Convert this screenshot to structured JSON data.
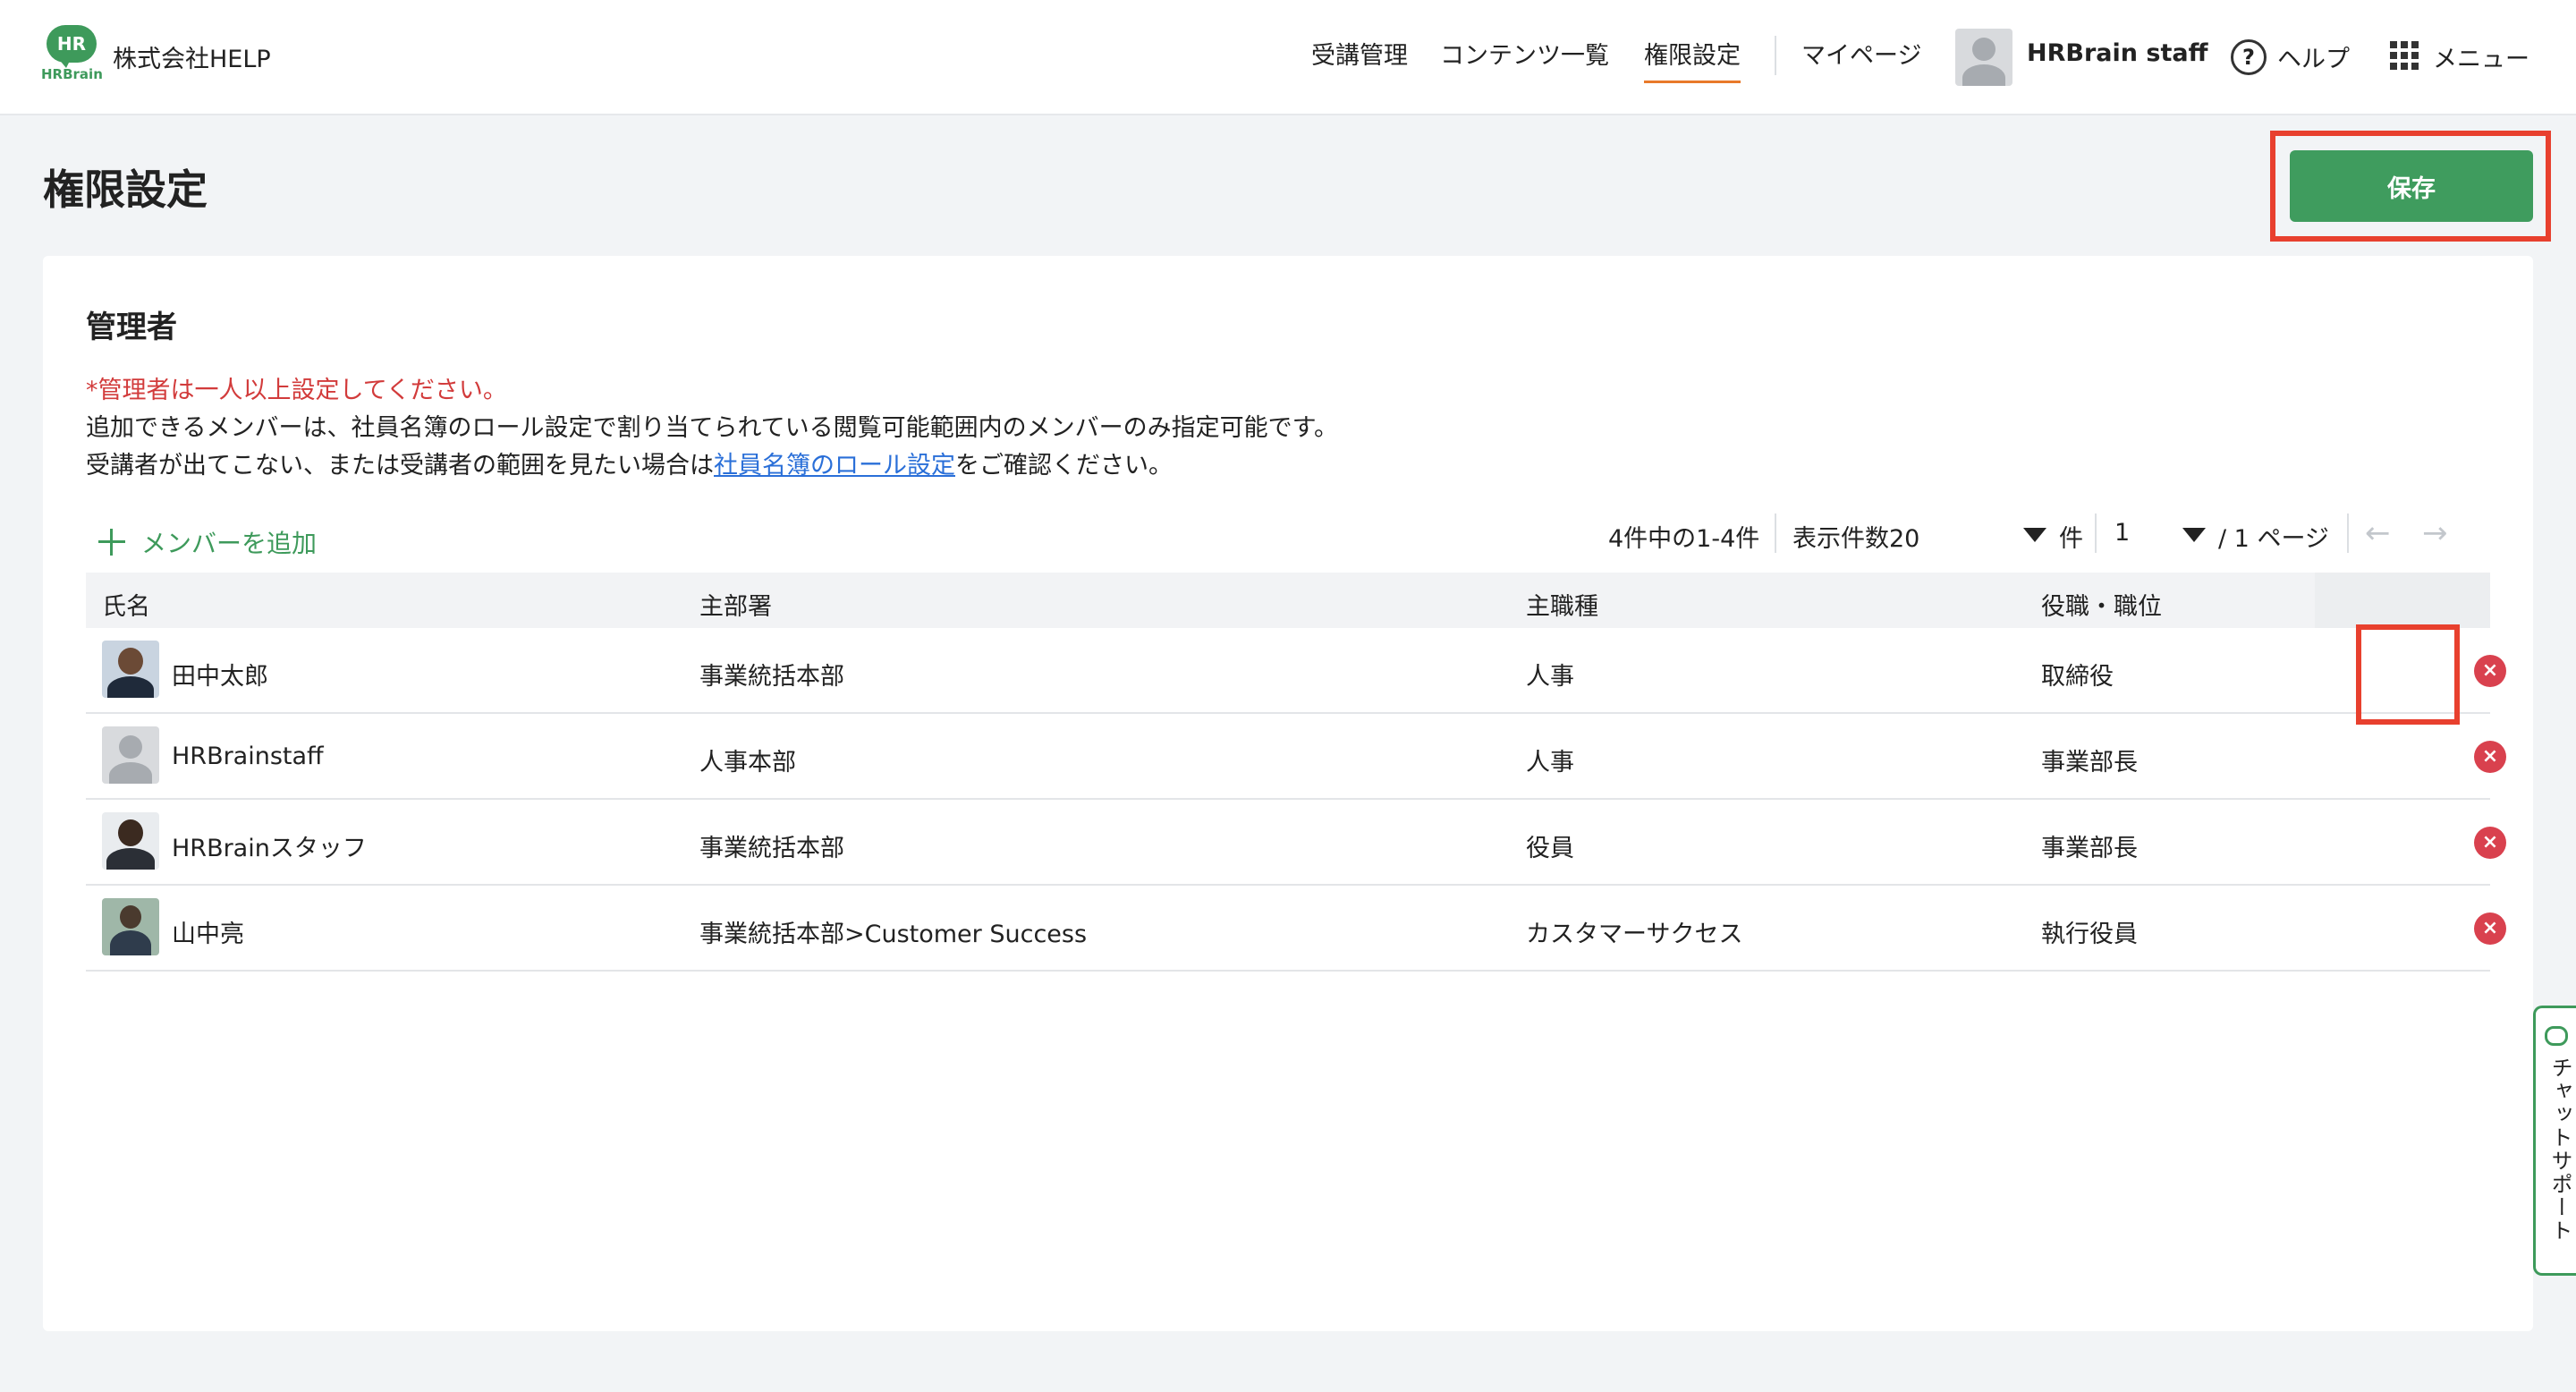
{
  "header": {
    "logo_text": "HR",
    "logo_sub": "HRBrain",
    "company": "株式会社HELP",
    "nav": [
      "受講管理",
      "コンテンツ一覧",
      "権限設定",
      "マイページ"
    ],
    "active_nav": "権限設定",
    "user_name": "HRBrain staff",
    "help_label": "ヘルプ",
    "menu_label": "メニュー"
  },
  "page": {
    "title": "権限設定",
    "save_label": "保存"
  },
  "section": {
    "title": "管理者",
    "required_note": "*管理者は一人以上設定してください。",
    "note_line1": "追加できるメンバーは、社員名簿のロール設定で割り当てられている閲覧可能範囲内のメンバーのみ指定可能です。",
    "note_line2_prefix": "受講者が出てこない、または受講者の範囲を見たい場合は",
    "note_line2_link": "社員名簿のロール設定",
    "note_line2_suffix": "をご確認ください。",
    "add_member_label": "メンバーを追加"
  },
  "pager": {
    "count_text": "4件中の1-4件",
    "per_page_label": "表示件数20",
    "unit_label": "件",
    "page_value": "1",
    "page_total": "/ 1 ページ",
    "prev_icon": "←",
    "next_icon": "→"
  },
  "table": {
    "columns": [
      "氏名",
      "主部署",
      "主職種",
      "役職・職位"
    ],
    "rows": [
      {
        "name": "田中太郎",
        "department": "事業統括本部",
        "job": "人事",
        "position": "取締役"
      },
      {
        "name": "HRBrainstaff",
        "department": "人事本部",
        "job": "人事",
        "position": "事業部長"
      },
      {
        "name": "HRBrainスタッフ",
        "department": "事業統括本部",
        "job": "役員",
        "position": "事業部長"
      },
      {
        "name": "山中亮",
        "department": "事業統括本部>Customer Success",
        "job": "カスタマーサクセス",
        "position": "執行役員"
      }
    ],
    "remove_icon": "×"
  },
  "chat": {
    "label": "チャットサポート"
  },
  "colors": {
    "accent_green": "#3f9c5e",
    "highlight_red": "#e8402e",
    "remove_red": "#d9414e",
    "link_blue": "#2a6fd8",
    "nav_underline": "#e8792a"
  }
}
